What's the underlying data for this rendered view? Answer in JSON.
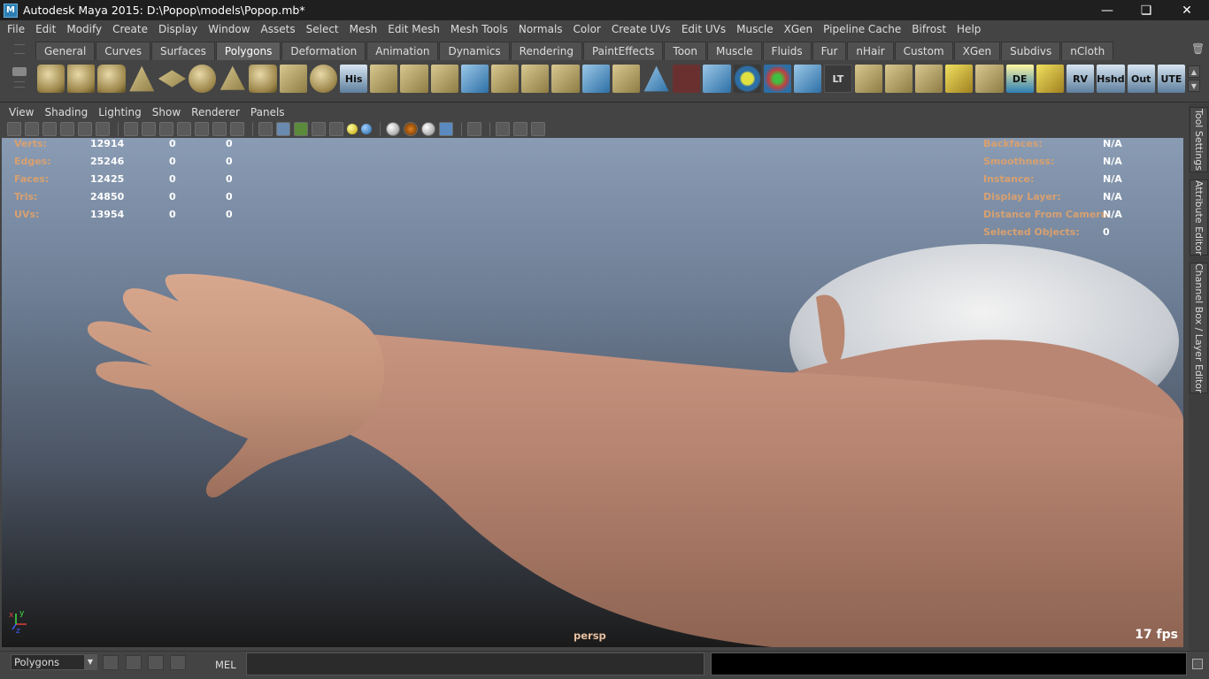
{
  "window": {
    "title": "Autodesk Maya 2015: D:\\Popop\\models\\Popop.mb*"
  },
  "menubar": [
    "File",
    "Edit",
    "Modify",
    "Create",
    "Display",
    "Window",
    "Assets",
    "Select",
    "Mesh",
    "Edit Mesh",
    "Mesh Tools",
    "Normals",
    "Color",
    "Create UVs",
    "Edit UVs",
    "Muscle",
    "XGen",
    "Pipeline Cache",
    "Bifrost",
    "Help"
  ],
  "shelf": {
    "tabs": [
      "General",
      "Curves",
      "Surfaces",
      "Polygons",
      "Deformation",
      "Animation",
      "Dynamics",
      "Rendering",
      "PaintEffects",
      "Toon",
      "Muscle",
      "Fluids",
      "Fur",
      "nHair",
      "Custom",
      "XGen",
      "Subdivs",
      "nCloth"
    ],
    "active_tab": "Polygons",
    "icon_labels": {
      "his": "His",
      "lt": "LT",
      "de": "DE",
      "rv": "RV",
      "hshd": "Hshd",
      "out": "Out",
      "ute": "UTE"
    }
  },
  "panel_menu": [
    "View",
    "Shading",
    "Lighting",
    "Show",
    "Renderer",
    "Panels"
  ],
  "hud_left": [
    {
      "label": "Verts:",
      "v1": "12914",
      "v2": "0",
      "v3": "0"
    },
    {
      "label": "Edges:",
      "v1": "25246",
      "v2": "0",
      "v3": "0"
    },
    {
      "label": "Faces:",
      "v1": "12425",
      "v2": "0",
      "v3": "0"
    },
    {
      "label": "Tris:",
      "v1": "24850",
      "v2": "0",
      "v3": "0"
    },
    {
      "label": "UVs:",
      "v1": "13954",
      "v2": "0",
      "v3": "0"
    }
  ],
  "hud_right": [
    {
      "label": "Backfaces:",
      "value": "N/A"
    },
    {
      "label": "Smoothness:",
      "value": "N/A"
    },
    {
      "label": "Instance:",
      "value": "N/A"
    },
    {
      "label": "Display Layer:",
      "value": "N/A"
    },
    {
      "label": "Distance From Camera:",
      "value": "N/A"
    },
    {
      "label": "Selected Objects:",
      "value": "0"
    }
  ],
  "viewport": {
    "camera": "persp",
    "fps": "17 fps",
    "axis_x": "x",
    "axis_y": "y",
    "axis_z": "z"
  },
  "side_tabs": [
    "Tool Settings",
    "Attribute Editor",
    "Channel Box / Layer Editor"
  ],
  "bottom": {
    "mode": "Polygons",
    "mel_label": "MEL"
  },
  "colors": {
    "skin": "#c99880",
    "hud_label": "#d8a070",
    "background_top": "#8a9cb4",
    "background_bottom": "#1a1a1a"
  }
}
